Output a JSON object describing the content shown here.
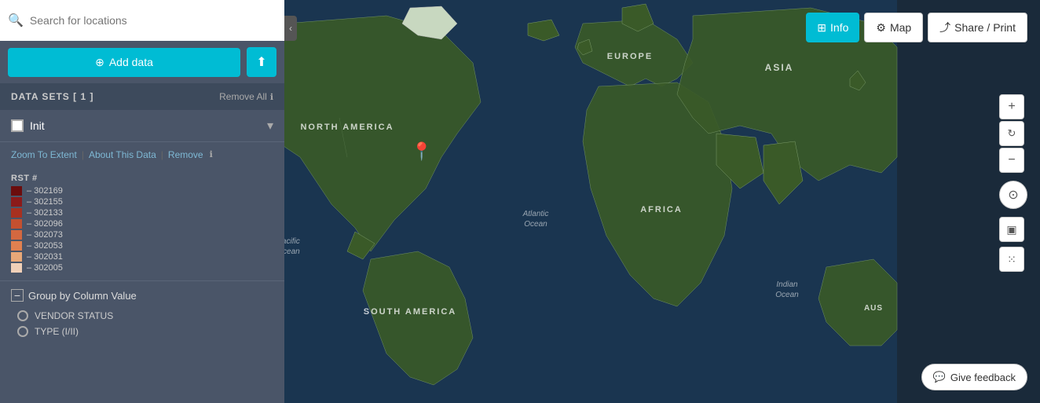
{
  "search": {
    "placeholder": "Search for locations"
  },
  "sidebar": {
    "add_data_label": "Add data",
    "datasets_title": "DATA SETS  [ 1 ]",
    "remove_all_label": "Remove All",
    "dataset_name": "Init",
    "zoom_to_extent": "Zoom To Extent",
    "about_this_data": "About This Data",
    "remove": "Remove",
    "legend_header": "RST  #",
    "legend_items": [
      {
        "color": "#6b0d0d",
        "label": "– 302169"
      },
      {
        "color": "#8b1a1a",
        "label": "– 302155"
      },
      {
        "color": "#a83020",
        "label": "– 302133"
      },
      {
        "color": "#c45030",
        "label": "– 302096"
      },
      {
        "color": "#d46840",
        "label": "– 302073"
      },
      {
        "color": "#e08050",
        "label": "– 302053"
      },
      {
        "color": "#e8a878",
        "label": "– 302031"
      },
      {
        "color": "#f0d0b8",
        "label": "– 302005"
      }
    ],
    "group_by_label": "Group by Column Value",
    "group_options": [
      {
        "label": "VENDOR STATUS"
      },
      {
        "label": "TYPE (I/II)"
      }
    ]
  },
  "header": {
    "info_label": "Info",
    "map_label": "Map",
    "share_label": "Share / Print"
  },
  "map": {
    "labels": [
      {
        "text": "NORTH AMERICA",
        "left": "590",
        "top": "155"
      },
      {
        "text": "SOUTH AMERICA",
        "left": "680",
        "top": "380"
      },
      {
        "text": "EUROPE",
        "left": "900",
        "top": "120"
      },
      {
        "text": "ASIA",
        "left": "1090",
        "top": "95"
      },
      {
        "text": "AFRICA",
        "left": "920",
        "top": "270"
      },
      {
        "text": "AUS",
        "left": "1230",
        "top": "370"
      }
    ],
    "ocean_labels": [
      {
        "text": "Pacific\nOcean",
        "left": "490",
        "top": "295"
      },
      {
        "text": "Atlantic\nOcean",
        "left": "780",
        "top": "260"
      },
      {
        "text": "Indian\nOcean",
        "left": "1080",
        "top": "360"
      }
    ],
    "pin_left": "720",
    "pin_top": "185"
  },
  "feedback": {
    "label": "Give feedback"
  },
  "icons": {
    "search": "🔍",
    "plus_circle": "⊕",
    "upload": "⬆",
    "chevron_down": "▾",
    "info_grid": "⊞",
    "map_sliders": "⚙",
    "share": "⤴",
    "zoom_plus": "+",
    "zoom_minus": "−",
    "refresh": "↻",
    "crosshair": "⊙",
    "layers": "▣",
    "settings_dots": "⁙",
    "chat_bubble": "💬",
    "plus_box": "⊞",
    "minus_box": "⊟"
  }
}
